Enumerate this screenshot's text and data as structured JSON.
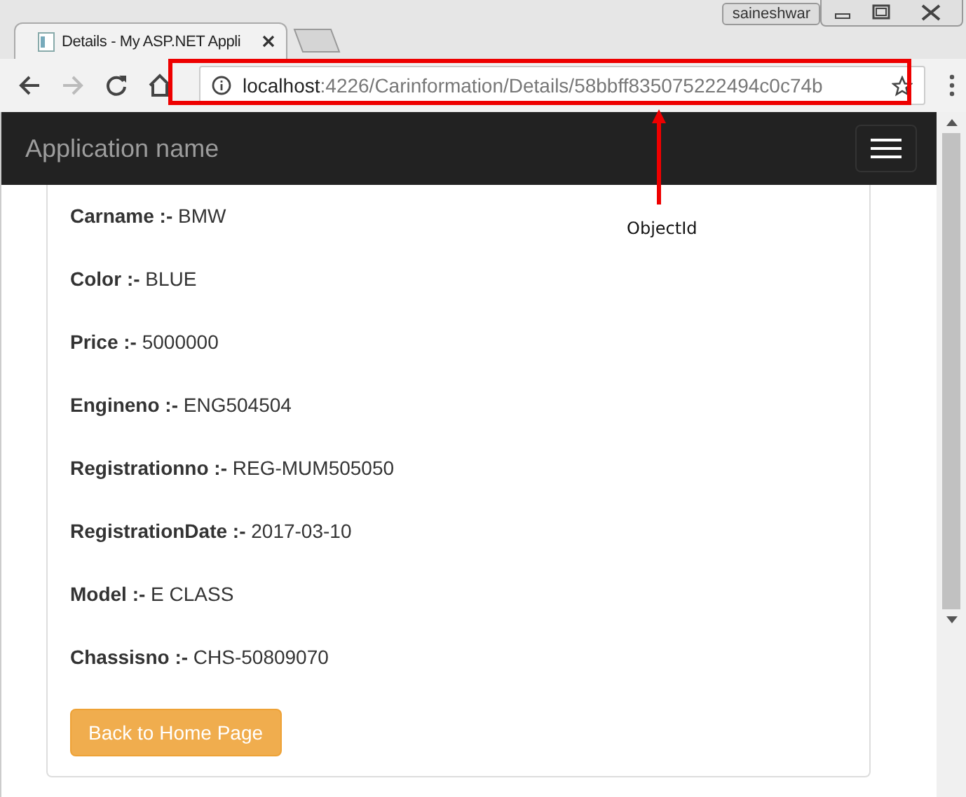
{
  "browser": {
    "user": "saineshwar",
    "tabs": [
      {
        "title": "Details - My ASP.NET Appli",
        "selected": true
      }
    ],
    "address": {
      "host": "localhost",
      "path": ":4226/Carinformation/Details/58bbff835075222494c0c74b"
    }
  },
  "navbar": {
    "brand": "Application name"
  },
  "annotation": {
    "label": "ObjectId"
  },
  "details": [
    "**Carname :-** BMW",
    "**Color :-** BLUE",
    "**Price :-** 5000000",
    "**Engineno :-** ENG504504",
    "**Registrationno :-** REG-MUM505050",
    "**RegistrationDate :-** 2017-03-10",
    "**Model :-** E CLASS",
    "**Chassisno :-** CHS-50809070"
  ],
  "button": "Back to Home Page"
}
